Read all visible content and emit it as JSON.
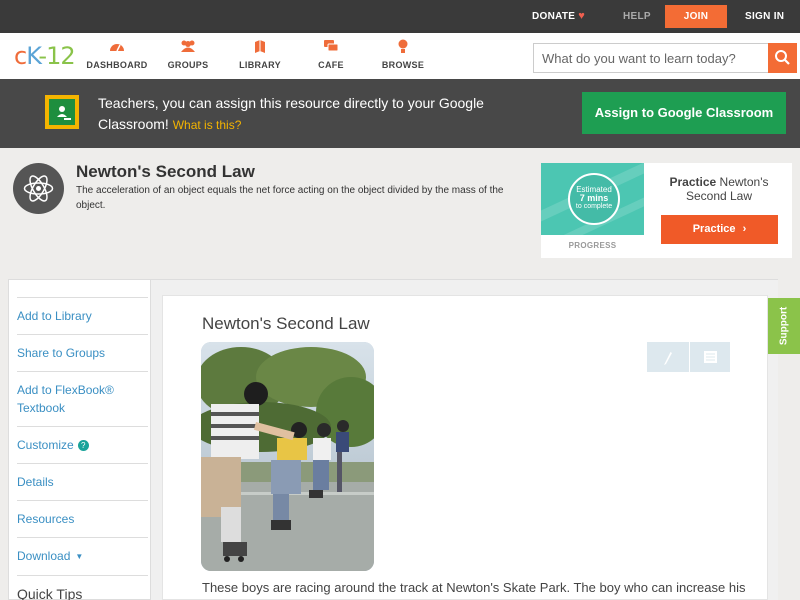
{
  "topbar": {
    "donate": "DONATE",
    "help": "HELP",
    "join": "JOIN",
    "signin": "SIGN IN"
  },
  "logo": {
    "part1": "c",
    "part2": "K",
    "part3": "-",
    "part4": "12"
  },
  "nav": [
    {
      "label": "DASHBOARD",
      "icon": "dashboard-icon"
    },
    {
      "label": "GROUPS",
      "icon": "groups-icon"
    },
    {
      "label": "LIBRARY",
      "icon": "library-icon"
    },
    {
      "label": "CAFE",
      "icon": "cafe-icon"
    },
    {
      "label": "BROWSE",
      "icon": "browse-icon"
    }
  ],
  "search": {
    "placeholder": "What do you want to learn today?"
  },
  "banner": {
    "text": "Teachers, you can assign this resource directly to your Google Classroom!",
    "link": "What is this?",
    "button": "Assign to Google Classroom"
  },
  "concept": {
    "title": "Newton's Second Law",
    "description": "The acceleration of an object equals the net force acting on the object divided by the mass of the object."
  },
  "practice": {
    "estimated": "Estimated",
    "mins": "7 mins",
    "complete": "to complete",
    "progress": "PROGRESS",
    "label_bold": "Practice",
    "label_rest": "Newton's Second Law",
    "button": "Practice"
  },
  "sidebar": {
    "items": [
      "Add to Library",
      "Share to Groups",
      "Add to FlexBook® Textbook",
      "Customize",
      "Details",
      "Resources",
      "Download"
    ],
    "quick_tips": "Quick Tips"
  },
  "article": {
    "title": "Newton's Second Law",
    "body": "These boys are racing around the track at Newton's Skate Park. The boy who can increase his"
  },
  "support": "Support",
  "colors": {
    "accent": "#f36c35",
    "link": "#3a8fc3",
    "google_green": "#1e9e52",
    "teal": "#4cc6b2",
    "support_green": "#8bc34a"
  }
}
